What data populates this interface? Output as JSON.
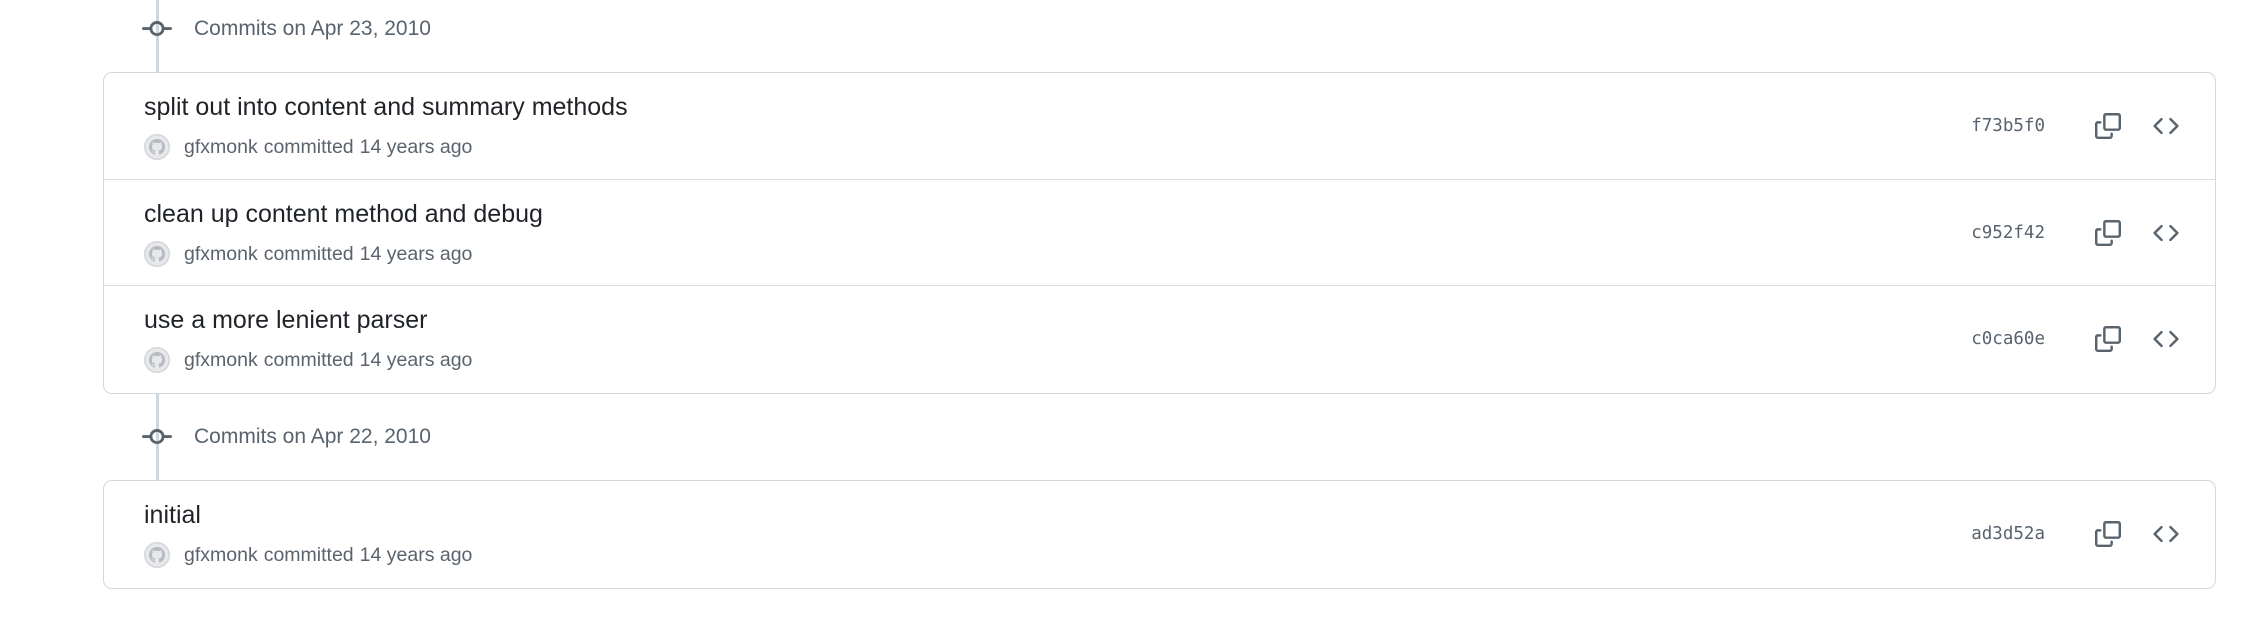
{
  "groups": [
    {
      "title": "Commits on Apr 23, 2010",
      "commits": [
        {
          "message": "split out into content and summary methods",
          "author": "gfxmonk",
          "verb": "committed",
          "time": "14 years ago",
          "sha": "f73b5f0"
        },
        {
          "message": "clean up content method and debug",
          "author": "gfxmonk",
          "verb": "committed",
          "time": "14 years ago",
          "sha": "c952f42"
        },
        {
          "message": "use a more lenient parser",
          "author": "gfxmonk",
          "verb": "committed",
          "time": "14 years ago",
          "sha": "c0ca60e"
        }
      ]
    },
    {
      "title": "Commits on Apr 22, 2010",
      "commits": [
        {
          "message": "initial",
          "author": "gfxmonk",
          "verb": "committed",
          "time": "14 years ago",
          "sha": "ad3d52a"
        }
      ]
    }
  ],
  "icons": {
    "group": "git-commit-icon",
    "avatar": "github-avatar-icon",
    "copy": "copy-icon",
    "browse": "code-icon"
  },
  "colors": {
    "text": "#1f2328",
    "muted": "#59636e",
    "border": "#d0d7de"
  }
}
